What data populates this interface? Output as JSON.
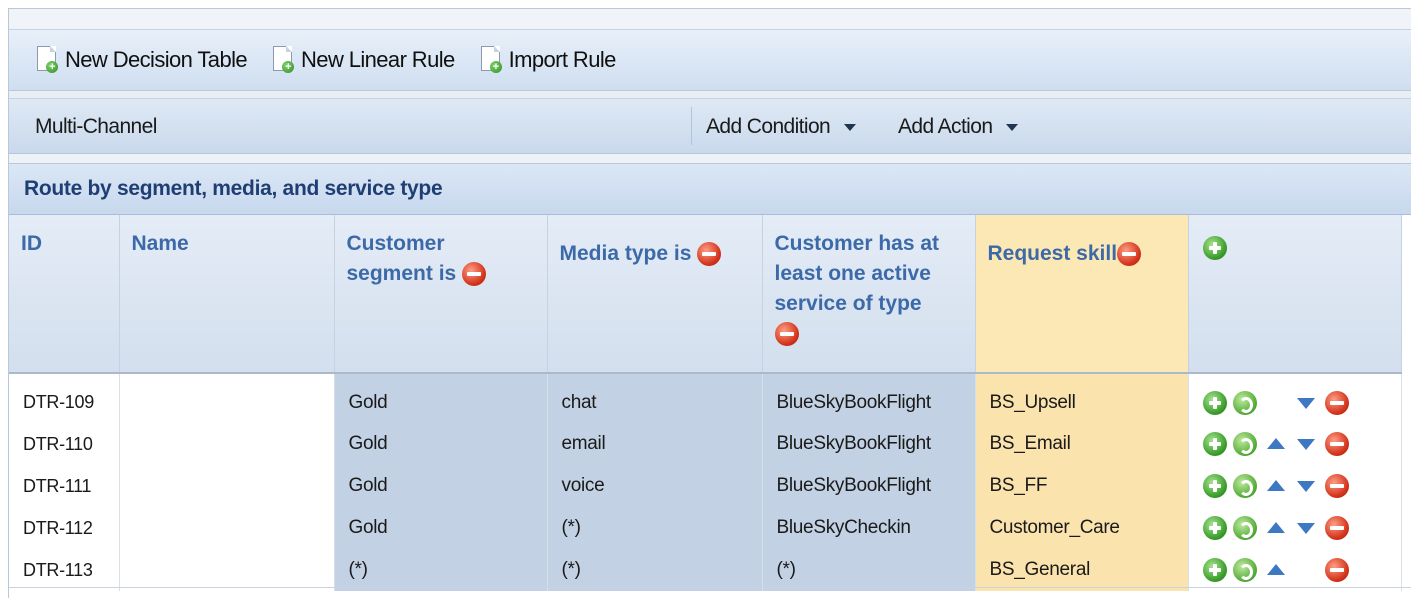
{
  "toolbar": {
    "new_decision_table": "New Decision Table",
    "new_linear_rule": "New Linear Rule",
    "import_rule": "Import Rule"
  },
  "rulebar": {
    "channel": "Multi-Channel",
    "add_condition": "Add Condition",
    "add_action": "Add Action"
  },
  "table": {
    "title": "Route by segment, media, and service type",
    "columns": {
      "id": "ID",
      "name": "Name",
      "segment": "Customer segment is",
      "media": "Media type is",
      "service": "Customer has at least one active service of type",
      "skill": "Request skill"
    },
    "rows": [
      {
        "id": "DTR-109",
        "name": "",
        "segment": "Gold",
        "media": "chat",
        "service": "BlueSkyBookFlight",
        "skill": "BS_Upsell"
      },
      {
        "id": "DTR-110",
        "name": "",
        "segment": "Gold",
        "media": "email",
        "service": "BlueSkyBookFlight",
        "skill": "BS_Email"
      },
      {
        "id": "DTR-111",
        "name": "",
        "segment": "Gold",
        "media": "voice",
        "service": "BlueSkyBookFlight",
        "skill": "BS_FF"
      },
      {
        "id": "DTR-112",
        "name": "",
        "segment": "Gold",
        "media": "(*)",
        "service": "BlueSkyCheckin",
        "skill": "Customer_Care"
      },
      {
        "id": "DTR-113",
        "name": "",
        "segment": "(*)",
        "media": "(*)",
        "service": "(*)",
        "skill": "BS_General"
      }
    ]
  },
  "colors": {
    "condition_cell": "#c3d1e5",
    "action_cell": "#fbe3ad",
    "header_text": "#3c6aa8",
    "title_text": "#1f3f74"
  }
}
